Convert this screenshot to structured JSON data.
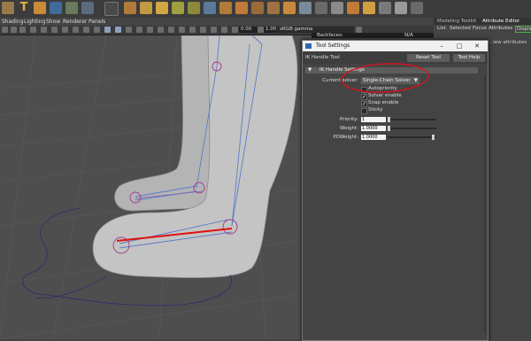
{
  "menubar": {
    "shading": "Shading",
    "lighting": "Lighting",
    "show": "Show",
    "renderer": "Renderer",
    "panels": "Panels"
  },
  "viewport_toolbar": {
    "field1": "0.00",
    "field2": "1.00",
    "color_space": "sRGB gamma"
  },
  "hud": {
    "backfaces_label": "Backfaces:",
    "backfaces_value": "N/A"
  },
  "right_panel": {
    "tabs": [
      "Modeling Toolkit",
      "Attribute Editor"
    ],
    "menu": [
      "List",
      "Selected",
      "Focus",
      "Attributes",
      "Display"
    ],
    "hint": "...iew attributes"
  },
  "dialog": {
    "title": "Tool Settings",
    "tool_name": "IK Handle Tool",
    "reset_button": "Reset Tool",
    "help_button": "Tool Help",
    "section": "IK Handle Settings",
    "current_solver_label": "Current solver:",
    "current_solver_value": "Single-Chain Solver",
    "checkboxes": [
      {
        "label": "Autopriority",
        "checked": false
      },
      {
        "label": "Solver enable",
        "checked": true
      },
      {
        "label": "Snap enable",
        "checked": true
      },
      {
        "label": "Sticky",
        "checked": false
      }
    ],
    "priority_label": "Priority:",
    "priority_value": "1",
    "weight_label": "Weight:",
    "weight_value": "1.0000",
    "poweight_label": "POWeight:",
    "poweight_value": "1.0000"
  },
  "colors": {
    "annotation": "#e0101a",
    "joint": "#a03a8a",
    "ik_handle": "#e01010",
    "bone_blue": "#5a7ec8",
    "curve": "#2a2a70"
  }
}
